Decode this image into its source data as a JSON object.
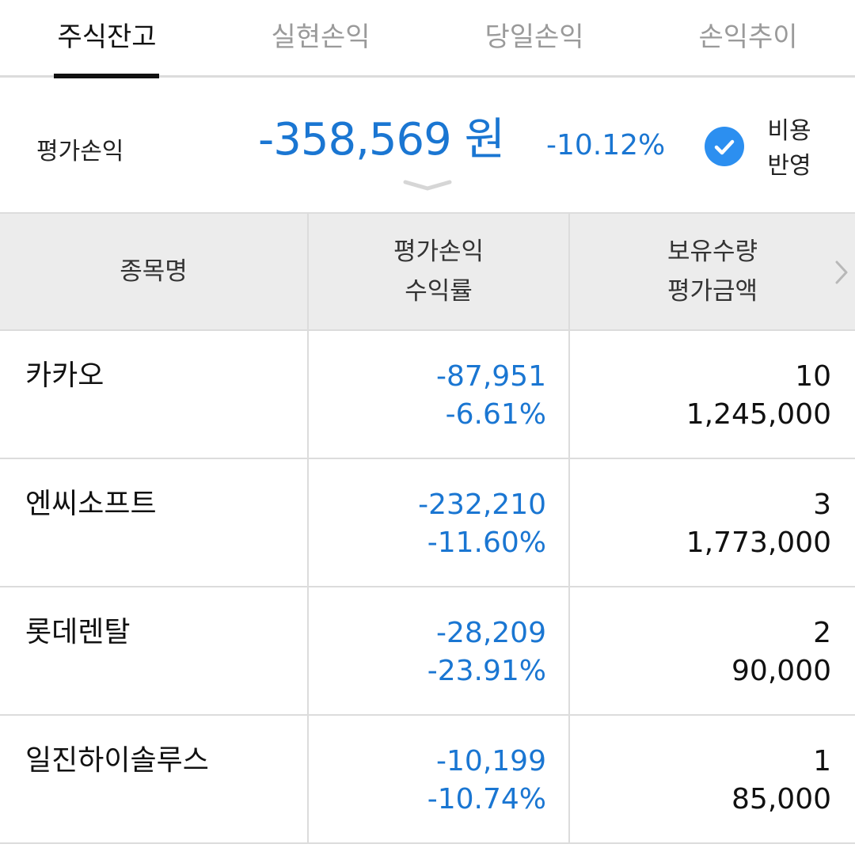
{
  "tabs": [
    {
      "label": "주식잔고",
      "active": true
    },
    {
      "label": "실현손익",
      "active": false
    },
    {
      "label": "당일손익",
      "active": false
    },
    {
      "label": "손익추이",
      "active": false
    }
  ],
  "summary": {
    "label": "평가손익",
    "amount": "-358,569 원",
    "rate": "-10.12%",
    "fee_toggle": {
      "line1": "비용",
      "line2": "반영",
      "checked": true
    }
  },
  "table": {
    "headers": {
      "name": "종목명",
      "pl_line1": "평가손익",
      "pl_line2": "수익률",
      "hold_line1": "보유수량",
      "hold_line2": "평가금액"
    },
    "rows": [
      {
        "name": "카카오",
        "pl": "-87,951",
        "rate": "-6.61%",
        "qty": "10",
        "value": "1,245,000"
      },
      {
        "name": "엔씨소프트",
        "pl": "-232,210",
        "rate": "-11.60%",
        "qty": "3",
        "value": "1,773,000"
      },
      {
        "name": "롯데렌탈",
        "pl": "-28,209",
        "rate": "-23.91%",
        "qty": "2",
        "value": "90,000"
      },
      {
        "name": "일진하이솔루스",
        "pl": "-10,199",
        "rate": "-10.74%",
        "qty": "1",
        "value": "85,000"
      }
    ]
  },
  "colors": {
    "negative": "#1a76d2",
    "check_accent": "#2c8ff0",
    "header_bg": "#ececec"
  }
}
